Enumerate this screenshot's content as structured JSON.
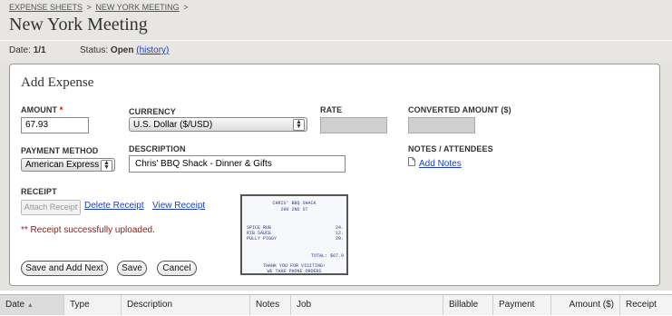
{
  "breadcrumb": {
    "items": [
      "EXPENSE SHEETS",
      "NEW YORK MEETING"
    ],
    "separator": ">"
  },
  "page_title": "New York Meeting",
  "status_bar": {
    "date_label": "Date:",
    "date_value": "1/1",
    "status_label": "Status:",
    "status_value": "Open",
    "history_link": "(history)"
  },
  "form": {
    "title": "Add Expense",
    "amount_label": "AMOUNT",
    "amount_required": "*",
    "amount_value": "67.93",
    "currency_label": "CURRENCY",
    "currency_value": "U.S. Dollar ($/USD)",
    "rate_label": "RATE",
    "converted_label": "CONVERTED AMOUNT ($)",
    "payment_label": "PAYMENT METHOD",
    "payment_value": "American Express",
    "description_label": "DESCRIPTION",
    "description_value": "Chris' BBQ Shack - Dinner & Gifts",
    "notes_label": "NOTES / ATTENDEES",
    "add_notes_link": "Add Notes",
    "receipt_label": "RECEIPT",
    "attach_receipt": "Attach Receipt",
    "delete_receipt": "Delete Receipt",
    "view_receipt": "View Receipt",
    "success_message": "** Receipt successfully uploaded.",
    "buttons": {
      "save_add_next": "Save and Add Next",
      "save": "Save",
      "cancel": "Cancel"
    }
  },
  "receipt_image": {
    "store": "CHRIS' BBQ SHACK",
    "address": "200 2ND ST",
    "items": [
      {
        "name": "SPICE RUB",
        "price": "24."
      },
      {
        "name": "RIB SAUCE",
        "price": "12."
      },
      {
        "name": "PULLY PIGGY",
        "price": "29."
      }
    ],
    "total": "TOTAL: $67.9",
    "footer1": "THANK YOU FOR VISITING!",
    "footer2": "WE TAKE PHONE ORDERS"
  },
  "table": {
    "columns": [
      "Date",
      "Type",
      "Description",
      "Notes",
      "Job",
      "Billable",
      "Payment",
      "Amount ($)",
      "Receipt"
    ],
    "sort_indicator": "▲"
  },
  "colors": {
    "link": "#1a3fc4",
    "header_bg": "#e8e6e3",
    "success_text": "#8b1a1a"
  }
}
